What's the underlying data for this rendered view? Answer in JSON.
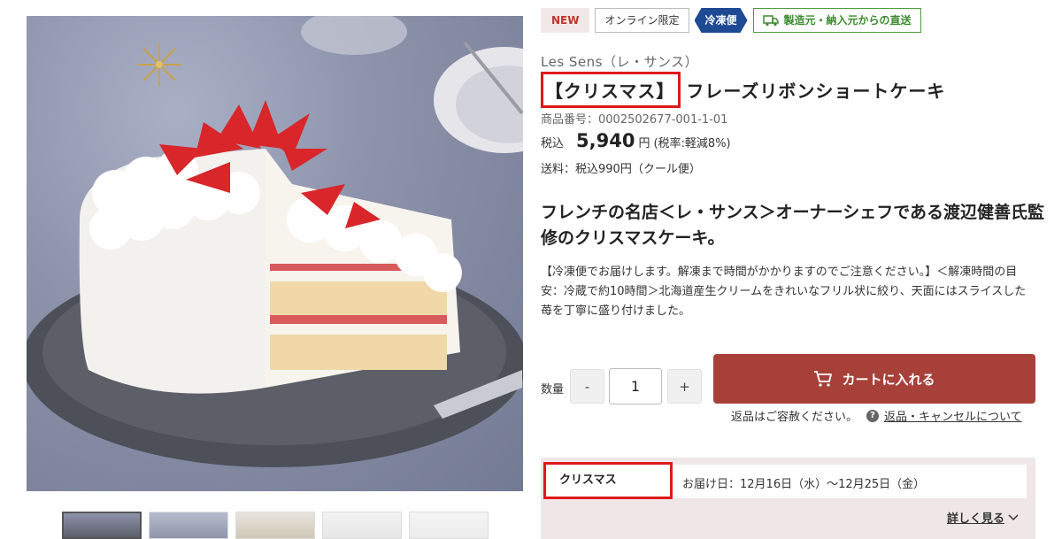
{
  "badges": {
    "new": "NEW",
    "online_only": "オンライン限定",
    "frozen": "冷凍便",
    "direct": "製造元・納入元からの直送"
  },
  "product": {
    "brand": "Les Sens（レ・サンス）",
    "title_highlight": "【クリスマス】",
    "title_rest": "フレーズリボンショートケーキ",
    "item_no": "商品番号：0002502677-001-1-01",
    "tax_label": "税込",
    "price": "5,940",
    "yen": "円",
    "tax_rate": "(税率:軽減8%)",
    "shipping": "送料：税込990円（クール便）",
    "headline": "フレンチの名店＜レ・サンス＞オーナーシェフである渡辺健善氏監修のクリスマスケーキ。",
    "description": "【冷凍便でお届けします。解凍まで時間がかかりますのでご注意ください。】＜解凍時間の目安：冷蔵で約10時間＞北海道産生クリームをきれいなフリル状に絞り、天面にはスライスした苺を丁寧に盛り付けました。"
  },
  "purchase": {
    "qty_label": "数量",
    "minus": "-",
    "plus": "+",
    "qty_value": "1",
    "cart_button": "カートに入れる",
    "returns_text": "返品はご容赦ください。",
    "returns_icon": "?",
    "returns_link": "返品・キャンセルについて"
  },
  "schedule": {
    "tag": "クリスマス",
    "date": "お届け日：12月16日（水）～12月25日（金）",
    "details": "詳しく見る"
  },
  "colors": {
    "cart": "#a8403a",
    "highlight": "#e01919",
    "frozen": "#1e4a93",
    "direct": "#3d8a30",
    "new": "#c0332b"
  }
}
